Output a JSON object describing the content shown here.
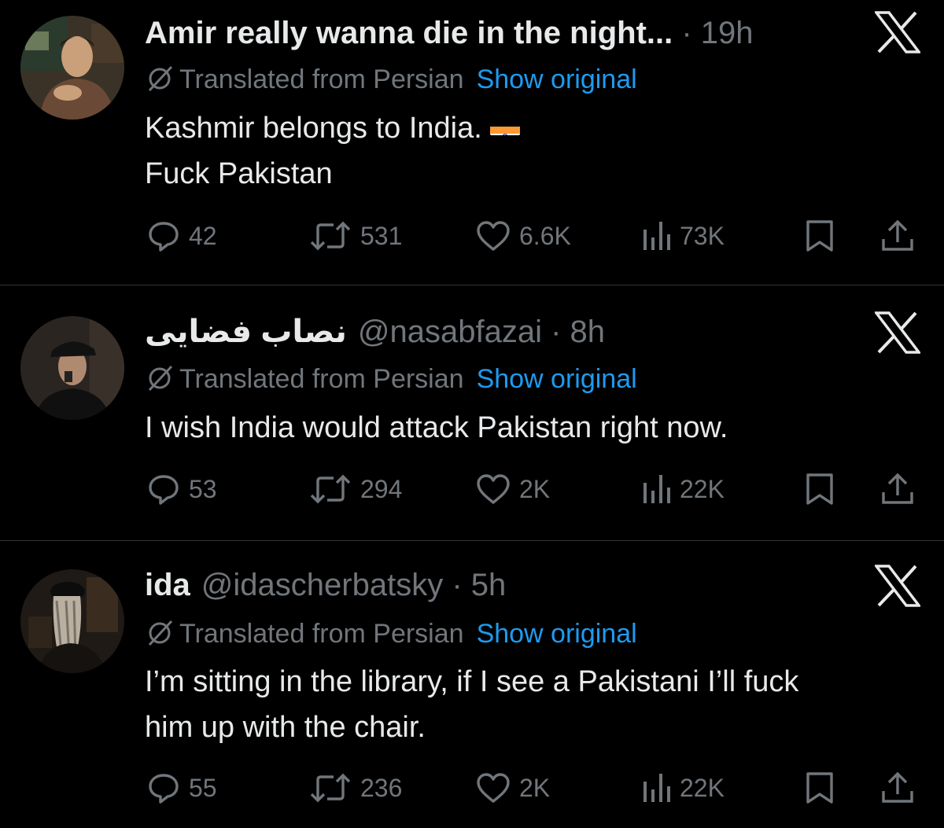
{
  "tweets": [
    {
      "name": "Amir really wanna die in the night...",
      "handle": "",
      "dot": " · ",
      "time": "19h",
      "translated_label": "Translated from Persian",
      "show_original_label": "Show original",
      "lines": [
        "Kashmir belongs to India.",
        "Fuck Pakistan"
      ],
      "flag_emoji": "india-flag",
      "replies": "42",
      "reposts": "531",
      "likes": "6.6K",
      "views": "73K"
    },
    {
      "name": "نصاب فضایی",
      "handle": "@nasabfazai",
      "dot": " · ",
      "time": "8h",
      "translated_label": "Translated from Persian",
      "show_original_label": "Show original",
      "lines": [
        "I wish India would attack Pakistan right now."
      ],
      "replies": "53",
      "reposts": "294",
      "likes": "2K",
      "views": "22K"
    },
    {
      "name": "ida",
      "handle": "@idascherbatsky",
      "dot": " · ",
      "time": "5h",
      "translated_label": "Translated from Persian",
      "show_original_label": "Show original",
      "lines": [
        "I’m sitting in the library, if I see a Pakistani I’ll fuck",
        "him up with the chair."
      ],
      "replies": "55",
      "reposts": "236",
      "likes": "2K",
      "views": "22K"
    }
  ],
  "icons": {
    "reply": "reply-icon",
    "repost": "repost-icon",
    "like": "heart-icon",
    "views": "views-icon",
    "bookmark": "bookmark-icon",
    "share": "share-icon",
    "translate": "translate-icon",
    "platform": "x-logo-icon"
  },
  "colors": {
    "background": "#000000",
    "text": "#e7e9ea",
    "secondary": "#71767b",
    "link": "#1d9bf0",
    "divider": "#2f3336"
  }
}
